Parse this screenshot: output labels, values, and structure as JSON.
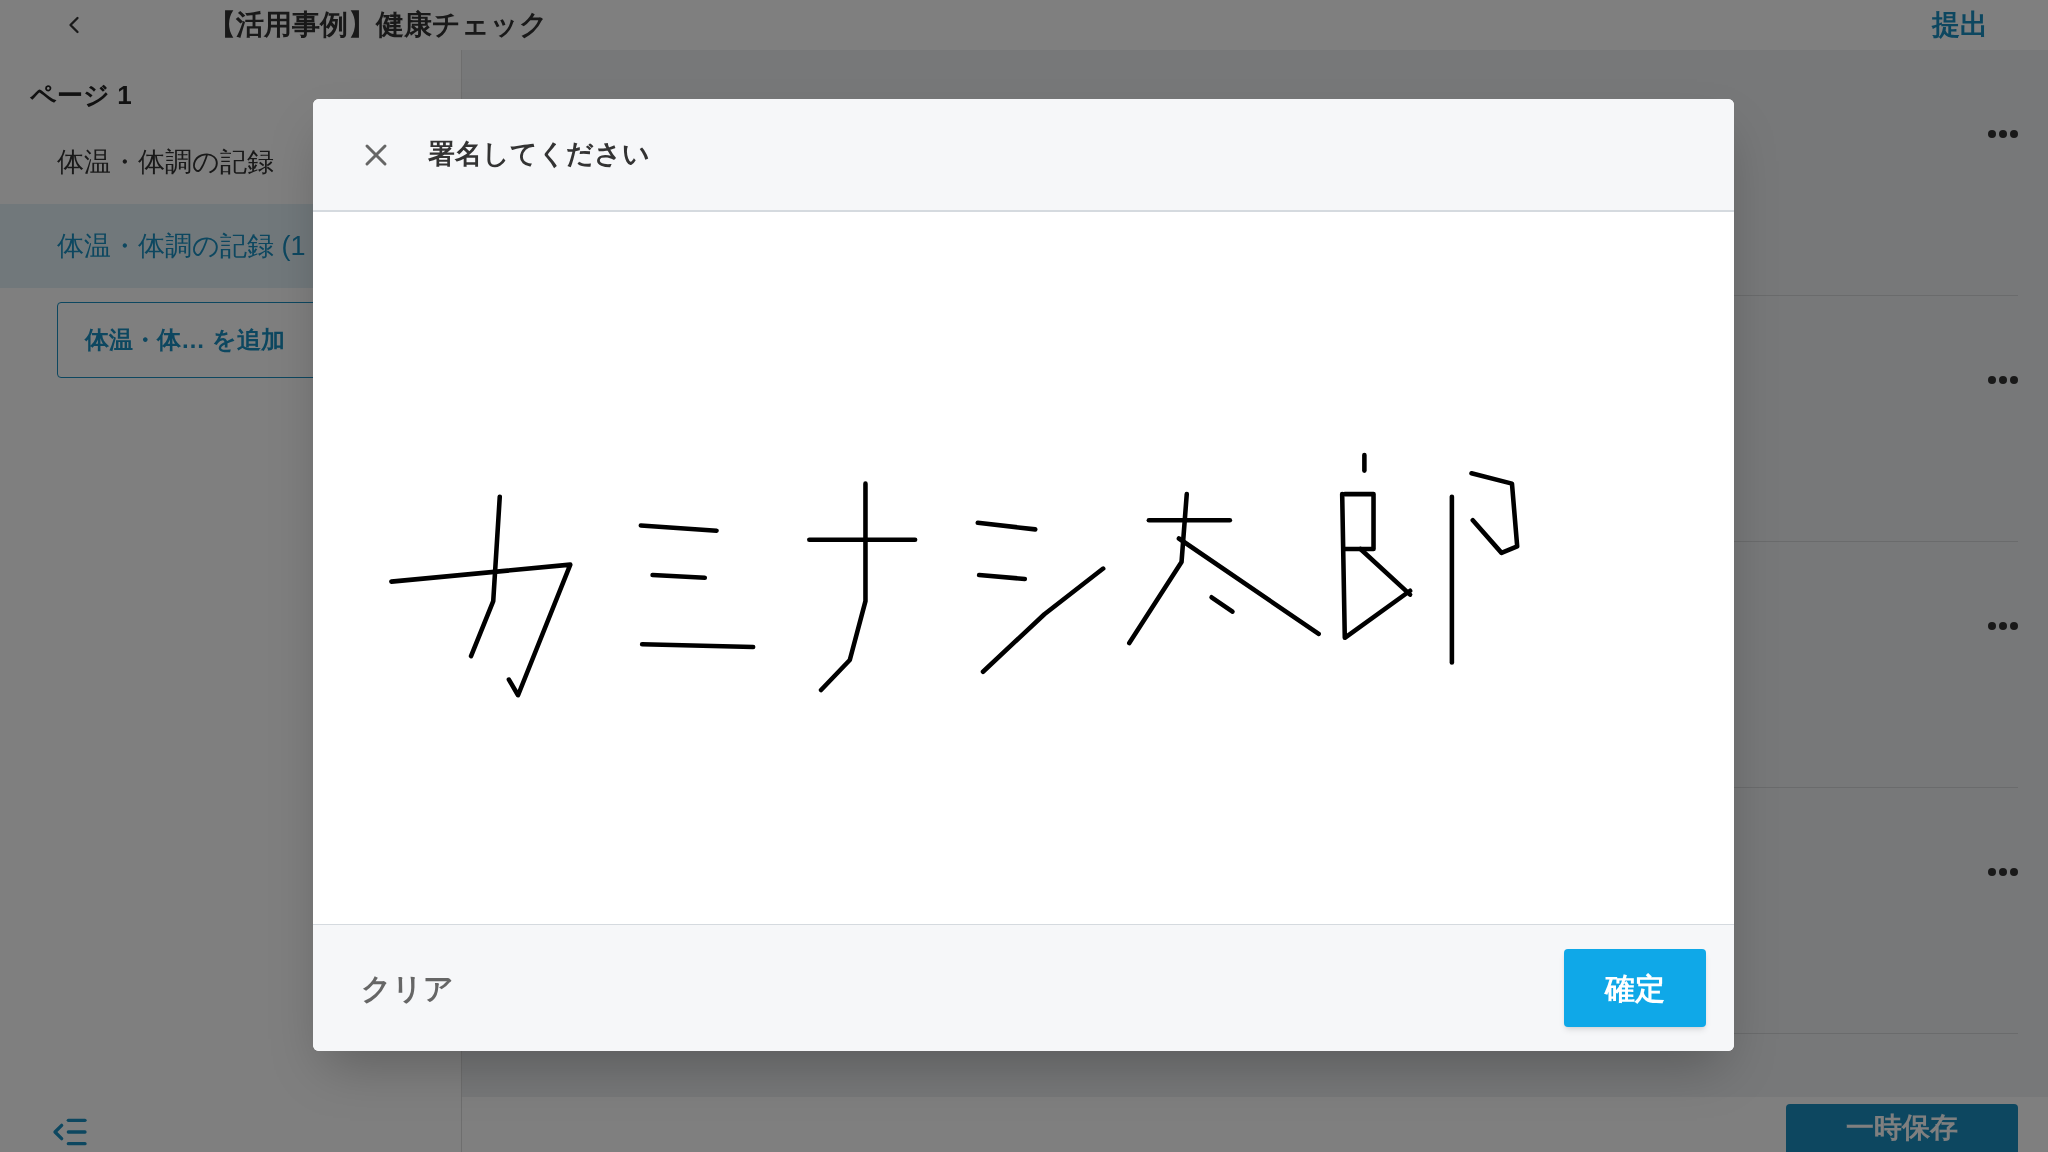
{
  "header": {
    "title": "【活用事例】健康チェック",
    "submit": "提出"
  },
  "sidebar": {
    "page_label": "ページ 1",
    "items": [
      {
        "label": "体温・体調の記録",
        "selected": false
      },
      {
        "label": "体温・体調の記録 (1",
        "selected": true
      }
    ],
    "add_button": "体温・体…  を追加"
  },
  "content": {
    "rows": [
      {
        "kind": "item"
      },
      {
        "kind": "item"
      },
      {
        "kind": "item"
      },
      {
        "kind": "item"
      }
    ]
  },
  "footer": {
    "save": "一時保存"
  },
  "dialog": {
    "title": "署名してください",
    "clear": "クリア",
    "confirm": "確定"
  }
}
